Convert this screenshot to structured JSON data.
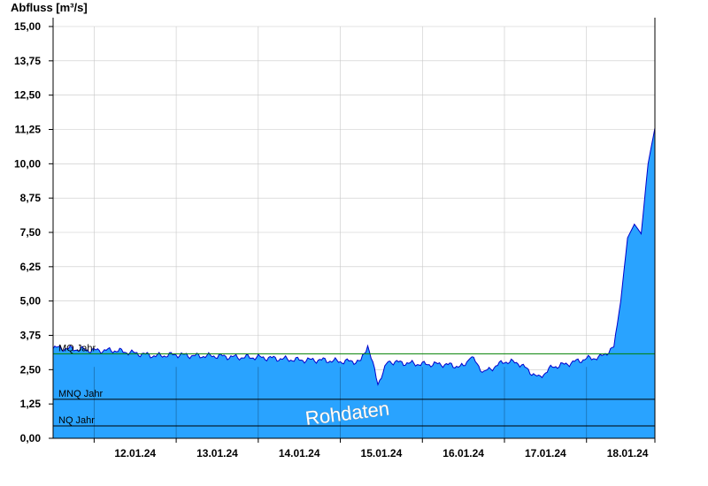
{
  "chart_data": {
    "type": "area",
    "ylabel": "Abfluss [m³/s]",
    "ylim": [
      0,
      15
    ],
    "y_ticks": [
      "0,00",
      "1,25",
      "2,50",
      "3,75",
      "5,00",
      "6,25",
      "7,50",
      "8,75",
      "10,00",
      "11,25",
      "12,50",
      "13,75",
      "15,00"
    ],
    "y_tick_values": [
      0,
      1.25,
      2.5,
      3.75,
      5,
      6.25,
      7.5,
      8.75,
      10,
      11.25,
      12.5,
      13.75,
      15
    ],
    "x_range_days": [
      "11.01.24 12:00",
      "18.01.24 20:00"
    ],
    "x_ticks": [
      "12.01.24",
      "13.01.24",
      "14.01.24",
      "15.01.24",
      "16.01.24",
      "17.01.24",
      "18.01.24"
    ],
    "grid": true,
    "colors": {
      "fill": "#29a3ff",
      "line": "#0000cc",
      "mq_line": "#008000",
      "ref_line": "#000000",
      "grid": "#c8c8c8"
    },
    "reference_lines": [
      {
        "label": "MQ Jahr",
        "value": 3.08
      },
      {
        "label": "MNQ Jahr",
        "value": 1.42
      },
      {
        "label": "NQ Jahr",
        "value": 0.45
      }
    ],
    "watermark": "Rohdaten",
    "series": [
      {
        "x": [
          "11.01.24 12:00",
          "11.01.24 18:00",
          "12.01.24 00:00",
          "12.01.24 06:00",
          "12.01.24 12:00",
          "12.01.24 18:00",
          "13.01.24 00:00",
          "13.01.24 06:00",
          "13.01.24 12:00",
          "13.01.24 18:00",
          "14.01.24 00:00",
          "14.01.24 06:00",
          "14.01.24 12:00",
          "14.01.24 18:00",
          "15.01.24 00:00",
          "15.01.24 06:00",
          "15.01.24 08:00",
          "15.01.24 11:00",
          "15.01.24 14:00",
          "15.01.24 18:00",
          "16.01.24 00:00",
          "16.01.24 06:00",
          "16.01.24 12:00",
          "16.01.24 14:00",
          "16.01.24 18:00",
          "17.01.24 00:00",
          "17.01.24 04:00",
          "17.01.24 10:00",
          "17.01.24 14:00",
          "17.01.24 18:00",
          "18.01.24 00:00",
          "18.01.24 04:00",
          "18.01.24 08:00",
          "18.01.24 10:00",
          "18.01.24 12:00",
          "18.01.24 14:00",
          "18.01.24 16:00",
          "18.01.24 18:00",
          "18.01.24 20:00"
        ],
        "y": [
          3.3,
          3.25,
          3.2,
          3.2,
          3.1,
          3.0,
          3.05,
          3.0,
          3.0,
          2.95,
          2.95,
          2.9,
          2.85,
          2.85,
          2.8,
          2.8,
          3.4,
          2.0,
          2.8,
          2.75,
          2.7,
          2.7,
          2.6,
          3.0,
          2.4,
          2.8,
          2.75,
          2.2,
          2.6,
          2.7,
          2.9,
          2.95,
          3.3,
          5.0,
          7.3,
          7.8,
          7.45,
          10.0,
          11.3
        ]
      }
    ]
  }
}
